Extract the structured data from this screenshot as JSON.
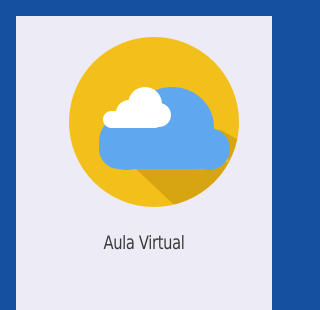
{
  "tile": {
    "label": "Aula Virtual",
    "icon": "cloud-icon"
  },
  "colors": {
    "frame": "#1550a0",
    "tile_background": "#ecebf6",
    "circle": "#f2bf1b",
    "circle_shadow": "#d8a512",
    "cloud_blue": "#5fa8f0",
    "cloud_white": "#ffffff",
    "label_text": "#3a3a3a"
  }
}
